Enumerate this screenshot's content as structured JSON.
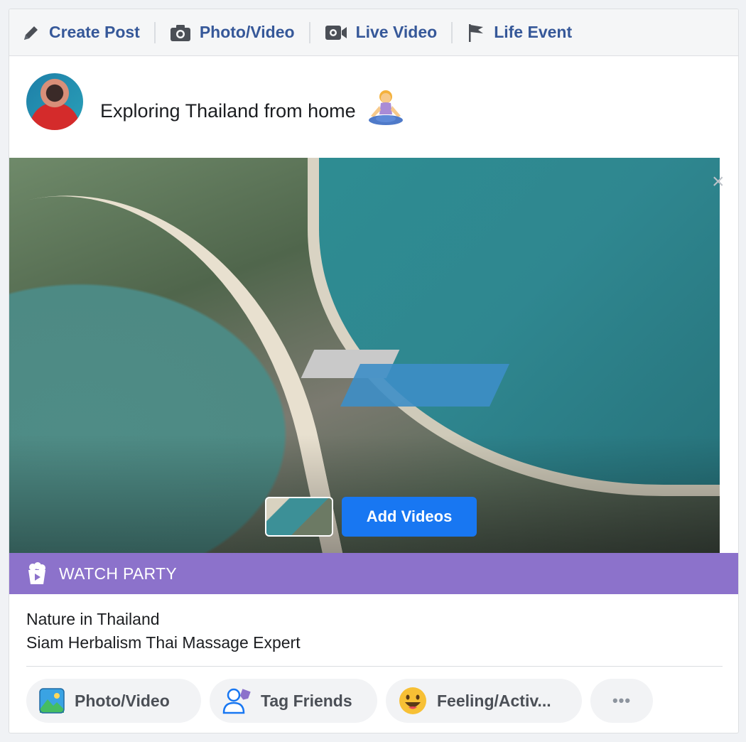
{
  "composer_tabs": {
    "create_post": "Create Post",
    "photo_video": "Photo/Video",
    "live_video": "Live Video",
    "life_event": "Life Event"
  },
  "post": {
    "text": "Exploring Thailand from home",
    "emoji": "woman-in-lotus-position"
  },
  "media": {
    "add_videos_label": "Add Videos",
    "close": "×"
  },
  "watch_party": {
    "label": "WATCH PARTY"
  },
  "info": {
    "line1": "Nature in Thailand",
    "line2": "Siam Herbalism Thai Massage Expert"
  },
  "actions": {
    "photo_video": "Photo/Video",
    "tag_friends": "Tag Friends",
    "feeling": "Feeling/Activ...",
    "more": "•••"
  },
  "colors": {
    "link": "#365899",
    "primary_button": "#1877f2",
    "watch_party_bar": "#8c72cb"
  }
}
